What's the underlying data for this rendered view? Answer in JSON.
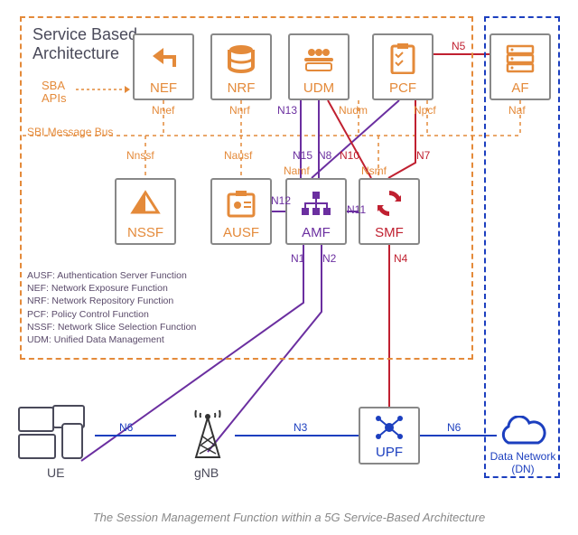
{
  "title": "Service Based Architecture",
  "caption": "The Session Management Function within a 5G Service-Based Architecture",
  "functions": {
    "nef": {
      "label": "NEF",
      "iface": "Nnef"
    },
    "nrf": {
      "label": "NRF",
      "iface": "Nnrf"
    },
    "udm": {
      "label": "UDM",
      "iface": "Nudm"
    },
    "pcf": {
      "label": "PCF",
      "iface": "Npcf"
    },
    "af": {
      "label": "AF",
      "iface": "Naf"
    },
    "nssf": {
      "label": "NSSF",
      "iface": "Nnssf"
    },
    "ausf": {
      "label": "AUSF",
      "iface": "Nausf"
    },
    "amf": {
      "label": "AMF",
      "iface": "Namf"
    },
    "smf": {
      "label": "SMF",
      "iface": "Nsmf"
    }
  },
  "bottom": {
    "ue": "UE",
    "gnb": "gNB",
    "upf": "UPF",
    "dn": "Data Network (DN)"
  },
  "refpoints": {
    "n1": "N1",
    "n2": "N2",
    "n3": "N3",
    "n4": "N4",
    "n5": "N5",
    "n6_left": "N6",
    "n6_right": "N6",
    "n7": "N7",
    "n8": "N8",
    "n10": "N10",
    "n11": "N11",
    "n12": "N12",
    "n13": "N13",
    "n15": "N15"
  },
  "sba_apis": "SBA APIs",
  "sbi_bus": "SBI Message Bus",
  "glossary": [
    "AUSF: Authentication Server Function",
    "NEF: Network Exposure Function",
    "NRF: Network Repository Function",
    "PCF: Policy Control Function",
    "NSSF: Network Slice Selection Function",
    "UDM: Unified Data Management"
  ]
}
